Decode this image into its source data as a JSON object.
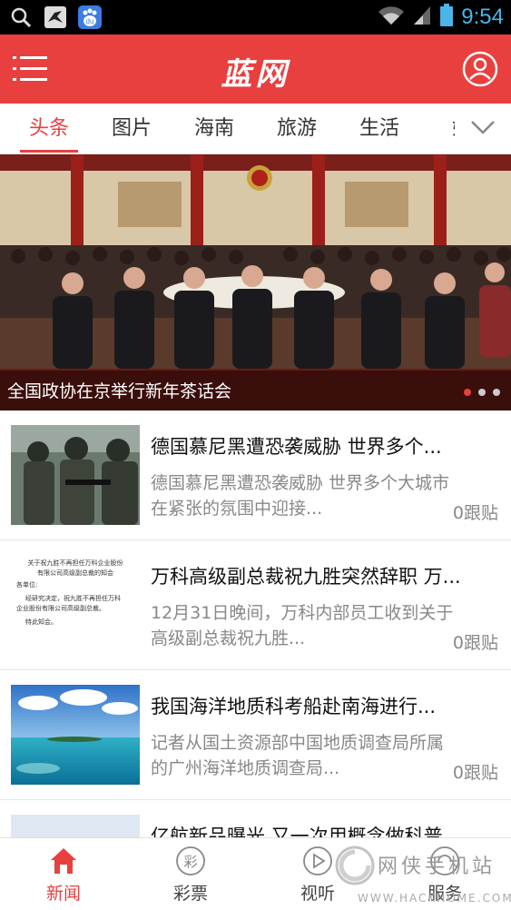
{
  "status_bar": {
    "time": "9:54",
    "icons": [
      "search-icon",
      "bird-icon",
      "baidu-icon",
      "wifi-icon",
      "signal-icon",
      "battery-icon"
    ],
    "baidu_text": "du"
  },
  "app_bar": {
    "title": "蓝网",
    "menu_icon": "menu-icon",
    "user_icon": "user-icon"
  },
  "tabs": [
    {
      "label": "头条",
      "active": true
    },
    {
      "label": "图片",
      "active": false
    },
    {
      "label": "海南",
      "active": false
    },
    {
      "label": "旅游",
      "active": false
    },
    {
      "label": "生活",
      "active": false
    },
    {
      "label": "娱",
      "active": false
    }
  ],
  "banner": {
    "caption": "全国政协在京举行新年茶话会",
    "total_slides": 3,
    "active_slide": 1
  },
  "news": [
    {
      "title": "德国慕尼黑遭恐袭威胁 世界多个...",
      "summary_line1": "德国慕尼黑遭恐袭威胁 世界多个大城市",
      "summary_line2": "在紧张的氛围中迎接...",
      "replies": "0跟贴"
    },
    {
      "title": "万科高级副总裁祝九胜突然辞职 万...",
      "summary_line1": "12月31日晚间，万科内部员工收到关于",
      "summary_line2": "高级副总裁祝九胜...",
      "replies": "0跟贴",
      "thumb_doc": {
        "line1": "关于祝九胜不再担任万科企业股份",
        "line2": "有限公司高级副总裁的知会",
        "line3": "各单位:",
        "line4": "经研究决定，祝九胜不再担任万科",
        "line5": "企业股份有限公司高级副总裁。",
        "line6": "特此知会。"
      }
    },
    {
      "title": "我国海洋地质科考船赴南海进行...",
      "summary_line1": "记者从国土资源部中国地质调查局所属",
      "summary_line2": "的广州海洋地质调查局...",
      "replies": "0跟贴"
    },
    {
      "title": "亿航新品曝光 又一次用概念做科普",
      "summary_line1": "",
      "summary_line2": "",
      "replies": ""
    }
  ],
  "bottom_nav": [
    {
      "label": "新闻",
      "icon": "home-icon",
      "active": true
    },
    {
      "label": "彩票",
      "icon": "lottery-icon",
      "icon_text": "彩",
      "active": false
    },
    {
      "label": "视听",
      "icon": "play-icon",
      "active": false
    },
    {
      "label": "服务",
      "icon": "service-icon",
      "active": false
    }
  ],
  "watermark": {
    "text": "网侠手机站",
    "url": "WWW.HACKHOME.COM"
  },
  "colors": {
    "brand_red": "#e8403f",
    "time_blue": "#49b5e8"
  }
}
